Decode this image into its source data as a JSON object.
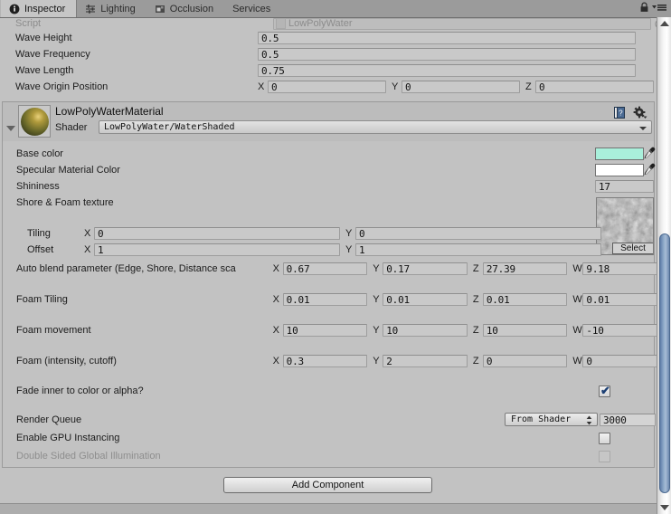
{
  "window": {
    "tabs": [
      {
        "label": "Inspector",
        "icon": "info-circle-icon",
        "active": true
      },
      {
        "label": "Lighting",
        "icon": "lighting-sliders-icon",
        "active": false
      },
      {
        "label": "Occlusion",
        "icon": "occlusion-icon",
        "active": false
      },
      {
        "label": "Services",
        "icon": "",
        "active": false
      }
    ],
    "lock_icon": "lock-icon",
    "menu_icon": "hamburger-menu-icon"
  },
  "script_row": {
    "label": "Script",
    "value": "LowPolyWater"
  },
  "component_properties": [
    {
      "label": "Wave Height",
      "type": "single",
      "value": "0.5"
    },
    {
      "label": "Wave Frequency",
      "type": "single",
      "value": "0.5"
    },
    {
      "label": "Wave Length",
      "type": "single",
      "value": "0.75"
    },
    {
      "label": "Wave Origin Position",
      "type": "vector3",
      "axes": [
        "X",
        "Y",
        "Z"
      ],
      "values": [
        "0",
        "0",
        "0"
      ]
    }
  ],
  "material": {
    "title": "LowPolyWaterMaterial",
    "shader_label": "Shader",
    "shader_value": "LowPolyWater/WaterShaded",
    "help_icon": "help-book-icon",
    "gear_icon": "gear-icon",
    "foldout_icon": "foldout-triangle-icon",
    "preview_icon": "material-preview-sphere",
    "properties": {
      "base_color": {
        "label": "Base color",
        "color": "#a9f0db",
        "eyedropper": "eyedropper-icon"
      },
      "specular_color": {
        "label": "Specular Material Color",
        "color": "#ffffff",
        "eyedropper": "eyedropper-icon"
      },
      "shininess": {
        "label": "Shininess",
        "value": "17"
      },
      "shore_foam_texture": {
        "label": "Shore & Foam texture",
        "select_label": "Select",
        "tiling": {
          "label": "Tiling",
          "axes": [
            "X",
            "Y"
          ],
          "values": [
            "0",
            "0"
          ]
        },
        "offset": {
          "label": "Offset",
          "axes": [
            "X",
            "Y"
          ],
          "values": [
            "1",
            "1"
          ]
        }
      },
      "auto_blend": {
        "label": "Auto blend parameter (Edge, Shore, Distance sca",
        "axes": [
          "X",
          "Y",
          "Z",
          "W"
        ],
        "values": [
          "0.67",
          "0.17",
          "27.39",
          "9.18"
        ]
      },
      "foam_tiling": {
        "label": "Foam Tiling",
        "axes": [
          "X",
          "Y",
          "Z",
          "W"
        ],
        "values": [
          "0.01",
          "0.01",
          "0.01",
          "0.01"
        ]
      },
      "foam_movement": {
        "label": "Foam movement",
        "axes": [
          "X",
          "Y",
          "Z",
          "W"
        ],
        "values": [
          "10",
          "10",
          "10",
          "-10"
        ]
      },
      "foam_intensity": {
        "label": "Foam (intensity, cutoff)",
        "axes": [
          "X",
          "Y",
          "Z",
          "W"
        ],
        "values": [
          "0.3",
          "2",
          "0",
          "0"
        ]
      },
      "fade_inner": {
        "label": "Fade inner to color or alpha?",
        "checked": true,
        "mark": "✔"
      },
      "render_queue": {
        "label": "Render Queue",
        "mode": "From Shader",
        "value": "3000"
      },
      "gpu_instancing": {
        "label": "Enable GPU Instancing",
        "checked": false
      },
      "double_sided_gi": {
        "label": "Double Sided Global Illumination",
        "checked": false,
        "disabled": true
      }
    }
  },
  "add_component": {
    "label": "Add Component"
  },
  "scrollbar": {
    "up_icon": "scroll-up-arrow-icon",
    "down_icon": "scroll-down-arrow-icon"
  },
  "colors": {
    "panel_bg": "#c2c2c2",
    "tabbar_bg": "#9b9b9b",
    "accent_check": "#1c3f73",
    "scroll_thumb": "#7d9cc2"
  }
}
